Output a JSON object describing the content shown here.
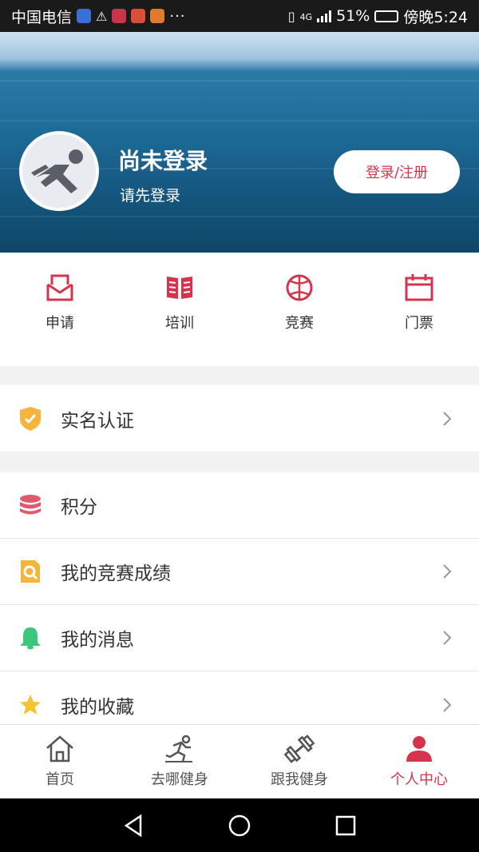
{
  "status_bar": {
    "carrier": "中国电信",
    "more": "···",
    "network": "4G",
    "battery_percent": "51%",
    "battery_level": 0.51,
    "time": "傍晚5:24"
  },
  "profile": {
    "name": "尚未登录",
    "subtitle": "请先登录",
    "login_button": "登录/注册",
    "avatar_icon": "runner-icon"
  },
  "quick_actions": [
    {
      "label": "申请",
      "icon": "envelope-icon"
    },
    {
      "label": "培训",
      "icon": "book-icon"
    },
    {
      "label": "竞赛",
      "icon": "basketball-icon"
    },
    {
      "label": "门票",
      "icon": "calendar-icon"
    }
  ],
  "menu_groups": {
    "verification": {
      "label": "实名认证",
      "icon": "shield-check-icon"
    },
    "items": [
      {
        "label": "积分",
        "icon": "coin-stack-icon"
      },
      {
        "label": "我的竞赛成绩",
        "icon": "search-document-icon"
      },
      {
        "label": "我的消息",
        "icon": "bell-icon"
      },
      {
        "label": "我的收藏",
        "icon": "star-icon"
      }
    ]
  },
  "tab_bar": [
    {
      "label": "首页",
      "icon": "home-icon"
    },
    {
      "label": "去哪健身",
      "icon": "running-icon"
    },
    {
      "label": "跟我健身",
      "icon": "dumbbell-icon"
    },
    {
      "label": "个人中心",
      "icon": "person-icon",
      "active": true
    }
  ],
  "colors": {
    "accent": "#d6344d",
    "shield": "#f5b43c",
    "coins": "#e05a6e",
    "search": "#f5b43c",
    "bell": "#3cc77a",
    "star": "#f5c232"
  }
}
